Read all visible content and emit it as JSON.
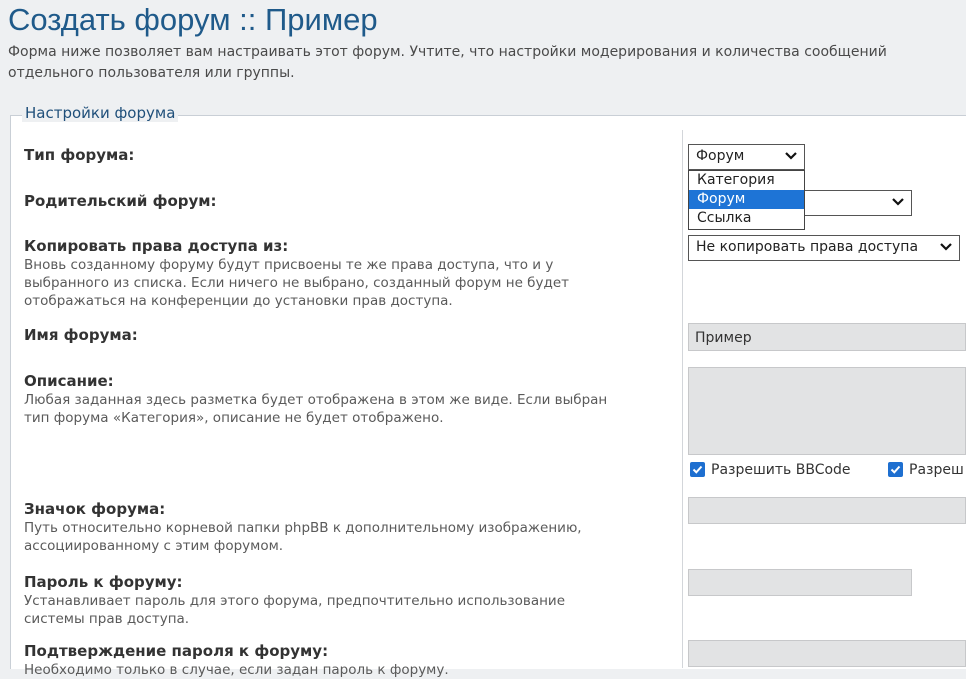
{
  "page": {
    "title": "Создать форум :: Пример",
    "description": "Форма ниже позволяет вам настраивать этот форум. Учтите, что настройки модерирования и количества сообщений\nотдельного пользователя или группы."
  },
  "panel": {
    "legend": "Настройки форума"
  },
  "fields": {
    "forum_type": {
      "label": "Тип форума:",
      "selected": "Форум",
      "options": [
        "Категория",
        "Форум",
        "Ссылка"
      ]
    },
    "parent_forum": {
      "label": "Родительский форум:"
    },
    "copy_permissions": {
      "label": "Копировать права доступа из:",
      "explain": "Вновь созданному форуму будут присвоены те же права доступа, что и у\nвыбранного из списка. Если ничего не выбрано, созданный форум не будет\nотображаться на конференции до установки прав доступа.",
      "selected": "Не копировать права доступа"
    },
    "forum_name": {
      "label": "Имя форума:",
      "value": "Пример"
    },
    "description": {
      "label": "Описание:",
      "explain": "Любая заданная здесь разметка будет отображена в этом же виде. Если выбран\nтип форума «Категория», описание не будет отображено.",
      "allow_bbcode_label": "Разрешить BBCode",
      "allow_second_label": "Разреш"
    },
    "forum_image": {
      "label": "Значок форума:",
      "explain": "Путь относительно корневой папки phpBB к дополнительному изображению,\nассоциированному с этим форумом."
    },
    "forum_password": {
      "label": "Пароль к форуму:",
      "explain": "Устанавливает пароль для этого форума, предпочтительно использование\nсистемы прав доступа."
    },
    "password_confirm": {
      "label": "Подтверждение пароля к форуму:",
      "explain": "Необходимо только в случае, если задан пароль к форуму."
    }
  },
  "colors": {
    "title": "#1f5a8a",
    "accent": "#1e74d6",
    "checkbox": "#1e6fd0"
  }
}
